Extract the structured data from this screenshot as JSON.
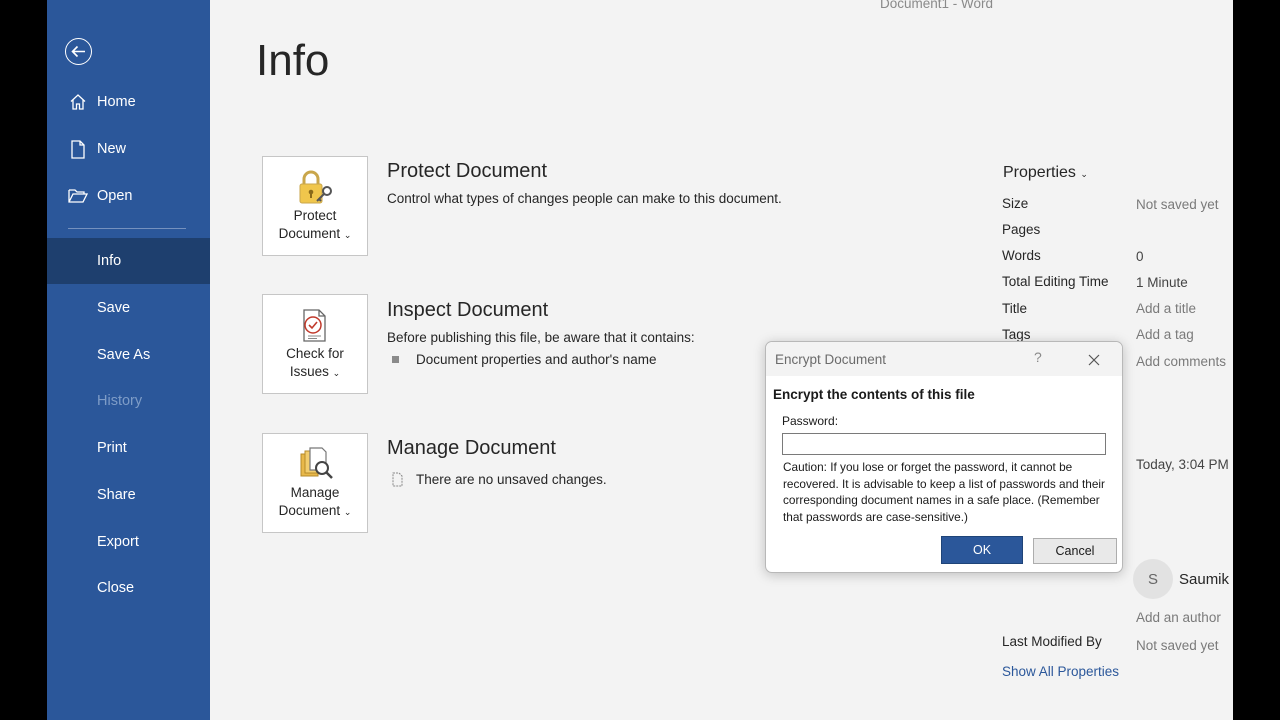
{
  "window": {
    "title": "Document1  -  Word"
  },
  "sidebar": {
    "items": [
      {
        "id": "home",
        "label": "Home",
        "icon": "home-icon"
      },
      {
        "id": "new",
        "label": "New",
        "icon": "new-document-icon"
      },
      {
        "id": "open",
        "label": "Open",
        "icon": "open-folder-icon"
      },
      {
        "id": "info",
        "label": "Info",
        "active": true
      },
      {
        "id": "save",
        "label": "Save"
      },
      {
        "id": "save-as",
        "label": "Save As"
      },
      {
        "id": "history",
        "label": "History",
        "disabled": true
      },
      {
        "id": "print",
        "label": "Print"
      },
      {
        "id": "share",
        "label": "Share"
      },
      {
        "id": "export",
        "label": "Export"
      },
      {
        "id": "close",
        "label": "Close"
      }
    ]
  },
  "main": {
    "title": "Info",
    "sections": [
      {
        "button_line1": "Protect",
        "button_line2": "Document",
        "icon": "lock-key-icon",
        "title": "Protect Document",
        "desc": "Control what types of changes people can make to this document."
      },
      {
        "button_line1": "Check for",
        "button_line2": "Issues",
        "icon": "inspect-document-icon",
        "title": "Inspect Document",
        "desc": "Before publishing this file, be aware that it contains:",
        "bullet": "Document properties and author's name"
      },
      {
        "button_line1": "Manage",
        "button_line2": "Document",
        "icon": "manage-document-icon",
        "title": "Manage Document",
        "bullet": "There are no unsaved changes."
      }
    ]
  },
  "properties": {
    "header": "Properties",
    "rows": [
      {
        "key": "Size",
        "value": "Not saved yet"
      },
      {
        "key": "Pages",
        "value": ""
      },
      {
        "key": "Words",
        "value": "0"
      },
      {
        "key": "Total Editing Time",
        "value": "1 Minute"
      },
      {
        "key": "Title",
        "value": "Add a title"
      },
      {
        "key": "Tags",
        "value": "Add a tag"
      },
      {
        "key": "",
        "value": "Add comments"
      }
    ],
    "created": "Today, 3:04 PM",
    "author_initial": "S",
    "author_name": "Saumik",
    "add_author": "Add an author",
    "last_modified_by_label": "Last Modified By",
    "last_modified_by_value": "Not saved yet",
    "show_all": "Show All Properties"
  },
  "dialog": {
    "title": "Encrypt Document",
    "help": "?",
    "heading": "Encrypt the contents of this file",
    "password_label": "Password:",
    "password_value": "",
    "caution": "Caution: If you lose or forget the password, it cannot be recovered. It is advisable to keep a list of passwords and their corresponding document names in a safe place. (Remember that passwords are case-sensitive.)",
    "ok": "OK",
    "cancel": "Cancel"
  },
  "colors": {
    "accent": "#2b579a",
    "sidebar_active": "#1e3f6e",
    "background": "#f3f3f3"
  }
}
